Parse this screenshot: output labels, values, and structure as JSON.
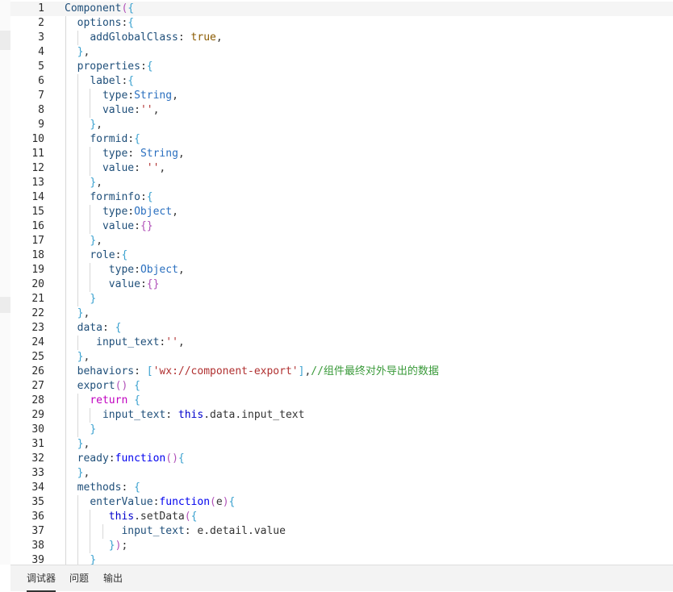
{
  "editor": {
    "lines": [
      [
        [
          "ident",
          "Component"
        ],
        [
          "paren",
          "("
        ],
        [
          "brace",
          "{"
        ]
      ],
      [
        [
          "plain",
          "  "
        ],
        [
          "key",
          "options"
        ],
        [
          "plain",
          ":"
        ],
        [
          "brace",
          "{"
        ]
      ],
      [
        [
          "plain",
          "    "
        ],
        [
          "key",
          "addGlobalClass"
        ],
        [
          "plain",
          ": "
        ],
        [
          "bool",
          "true"
        ],
        [
          "plain",
          ","
        ]
      ],
      [
        [
          "plain",
          "  "
        ],
        [
          "brace",
          "}"
        ],
        [
          "plain",
          ","
        ]
      ],
      [
        [
          "plain",
          "  "
        ],
        [
          "key",
          "properties"
        ],
        [
          "plain",
          ":"
        ],
        [
          "brace",
          "{"
        ]
      ],
      [
        [
          "plain",
          "    "
        ],
        [
          "key",
          "label"
        ],
        [
          "plain",
          ":"
        ],
        [
          "brace",
          "{"
        ]
      ],
      [
        [
          "plain",
          "      "
        ],
        [
          "key",
          "type"
        ],
        [
          "plain",
          ":"
        ],
        [
          "type",
          "String"
        ],
        [
          "plain",
          ","
        ]
      ],
      [
        [
          "plain",
          "      "
        ],
        [
          "key",
          "value"
        ],
        [
          "plain",
          ":"
        ],
        [
          "str",
          "''"
        ],
        [
          "plain",
          ","
        ]
      ],
      [
        [
          "plain",
          "    "
        ],
        [
          "brace",
          "}"
        ],
        [
          "plain",
          ","
        ]
      ],
      [
        [
          "plain",
          "    "
        ],
        [
          "key",
          "formid"
        ],
        [
          "plain",
          ":"
        ],
        [
          "brace",
          "{"
        ]
      ],
      [
        [
          "plain",
          "      "
        ],
        [
          "key",
          "type"
        ],
        [
          "plain",
          ": "
        ],
        [
          "type",
          "String"
        ],
        [
          "plain",
          ","
        ]
      ],
      [
        [
          "plain",
          "      "
        ],
        [
          "key",
          "value"
        ],
        [
          "plain",
          ": "
        ],
        [
          "str",
          "''"
        ],
        [
          "plain",
          ","
        ]
      ],
      [
        [
          "plain",
          "    "
        ],
        [
          "brace",
          "}"
        ],
        [
          "plain",
          ","
        ]
      ],
      [
        [
          "plain",
          "    "
        ],
        [
          "key",
          "forminfo"
        ],
        [
          "plain",
          ":"
        ],
        [
          "brace",
          "{"
        ]
      ],
      [
        [
          "plain",
          "      "
        ],
        [
          "key",
          "type"
        ],
        [
          "plain",
          ":"
        ],
        [
          "type",
          "Object"
        ],
        [
          "plain",
          ","
        ]
      ],
      [
        [
          "plain",
          "      "
        ],
        [
          "key",
          "value"
        ],
        [
          "plain",
          ":"
        ],
        [
          "paren",
          "{}"
        ]
      ],
      [
        [
          "plain",
          "    "
        ],
        [
          "brace",
          "}"
        ],
        [
          "plain",
          ","
        ]
      ],
      [
        [
          "plain",
          "    "
        ],
        [
          "key",
          "role"
        ],
        [
          "plain",
          ":"
        ],
        [
          "brace",
          "{"
        ]
      ],
      [
        [
          "plain",
          "       "
        ],
        [
          "key",
          "type"
        ],
        [
          "plain",
          ":"
        ],
        [
          "type",
          "Object"
        ],
        [
          "plain",
          ","
        ]
      ],
      [
        [
          "plain",
          "       "
        ],
        [
          "key",
          "value"
        ],
        [
          "plain",
          ":"
        ],
        [
          "paren",
          "{}"
        ]
      ],
      [
        [
          "plain",
          "    "
        ],
        [
          "brace",
          "}"
        ]
      ],
      [
        [
          "plain",
          "  "
        ],
        [
          "brace",
          "}"
        ],
        [
          "plain",
          ","
        ]
      ],
      [
        [
          "plain",
          "  "
        ],
        [
          "key",
          "data"
        ],
        [
          "plain",
          ": "
        ],
        [
          "brace",
          "{"
        ]
      ],
      [
        [
          "plain",
          "     "
        ],
        [
          "key",
          "input_text"
        ],
        [
          "plain",
          ":"
        ],
        [
          "str",
          "''"
        ],
        [
          "plain",
          ","
        ]
      ],
      [
        [
          "plain",
          "  "
        ],
        [
          "brace",
          "}"
        ],
        [
          "plain",
          ","
        ]
      ],
      [
        [
          "plain",
          "  "
        ],
        [
          "key",
          "behaviors"
        ],
        [
          "plain",
          ": "
        ],
        [
          "brace",
          "["
        ],
        [
          "str",
          "'wx://component-export'"
        ],
        [
          "brace",
          "]"
        ],
        [
          "plain",
          ","
        ],
        [
          "cmt",
          "//组件最终对外导出的数据"
        ]
      ],
      [
        [
          "plain",
          "  "
        ],
        [
          "ident",
          "export"
        ],
        [
          "paren",
          "()"
        ],
        [
          "plain",
          " "
        ],
        [
          "brace",
          "{"
        ]
      ],
      [
        [
          "plain",
          "    "
        ],
        [
          "kw",
          "return"
        ],
        [
          "plain",
          " "
        ],
        [
          "brace",
          "{"
        ]
      ],
      [
        [
          "plain",
          "      "
        ],
        [
          "key",
          "input_text"
        ],
        [
          "plain",
          ": "
        ],
        [
          "this",
          "this"
        ],
        [
          "plain",
          ".data.input_text"
        ]
      ],
      [
        [
          "plain",
          "    "
        ],
        [
          "brace",
          "}"
        ]
      ],
      [
        [
          "plain",
          "  "
        ],
        [
          "brace",
          "}"
        ],
        [
          "plain",
          ","
        ]
      ],
      [
        [
          "plain",
          "  "
        ],
        [
          "key",
          "ready"
        ],
        [
          "plain",
          ":"
        ],
        [
          "fn",
          "function"
        ],
        [
          "paren",
          "()"
        ],
        [
          "brace",
          "{"
        ]
      ],
      [
        [
          "plain",
          "  "
        ],
        [
          "brace",
          "}"
        ],
        [
          "plain",
          ","
        ]
      ],
      [
        [
          "plain",
          "  "
        ],
        [
          "key",
          "methods"
        ],
        [
          "plain",
          ": "
        ],
        [
          "brace",
          "{"
        ]
      ],
      [
        [
          "plain",
          "    "
        ],
        [
          "key",
          "enterValue"
        ],
        [
          "plain",
          ":"
        ],
        [
          "fn",
          "function"
        ],
        [
          "paren",
          "("
        ],
        [
          "plain",
          "e"
        ],
        [
          "paren",
          ")"
        ],
        [
          "brace",
          "{"
        ]
      ],
      [
        [
          "plain",
          "       "
        ],
        [
          "this",
          "this"
        ],
        [
          "plain",
          ".setData"
        ],
        [
          "paren",
          "("
        ],
        [
          "brace",
          "{"
        ]
      ],
      [
        [
          "plain",
          "         "
        ],
        [
          "key",
          "input_text"
        ],
        [
          "plain",
          ": e.detail.value"
        ]
      ],
      [
        [
          "plain",
          "       "
        ],
        [
          "brace",
          "}"
        ],
        [
          "paren",
          ")"
        ],
        [
          "plain",
          ";"
        ]
      ],
      [
        [
          "plain",
          "    "
        ],
        [
          "brace",
          "}"
        ]
      ]
    ]
  },
  "bottom_tabs": [
    {
      "label": "调试器",
      "active": true
    },
    {
      "label": "问题",
      "active": false
    },
    {
      "label": "输出",
      "active": false
    }
  ]
}
